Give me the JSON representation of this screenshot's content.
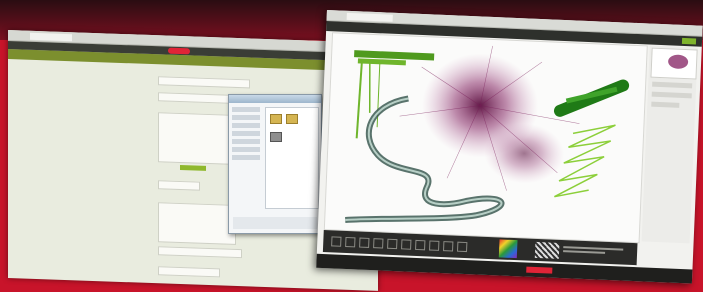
{
  "colors": {
    "background": "#c8142a",
    "accent_green": "#7c8f2e",
    "brand_red": "#e02437",
    "brush_purple": "#7a1f5a",
    "brush_green": "#4f9a1e",
    "brush_teal": "#3c5a52"
  },
  "left_window": {
    "header_title": "",
    "icons": {
      "logo": "red-logo-icon",
      "folder": "folder-icon"
    }
  },
  "right_window": {
    "icons": {
      "color-picker": "color-wheel-icon",
      "pattern": "striped-pattern-icon"
    }
  },
  "background_text": {
    "line1": "",
    "line2": "",
    "line3": ""
  }
}
